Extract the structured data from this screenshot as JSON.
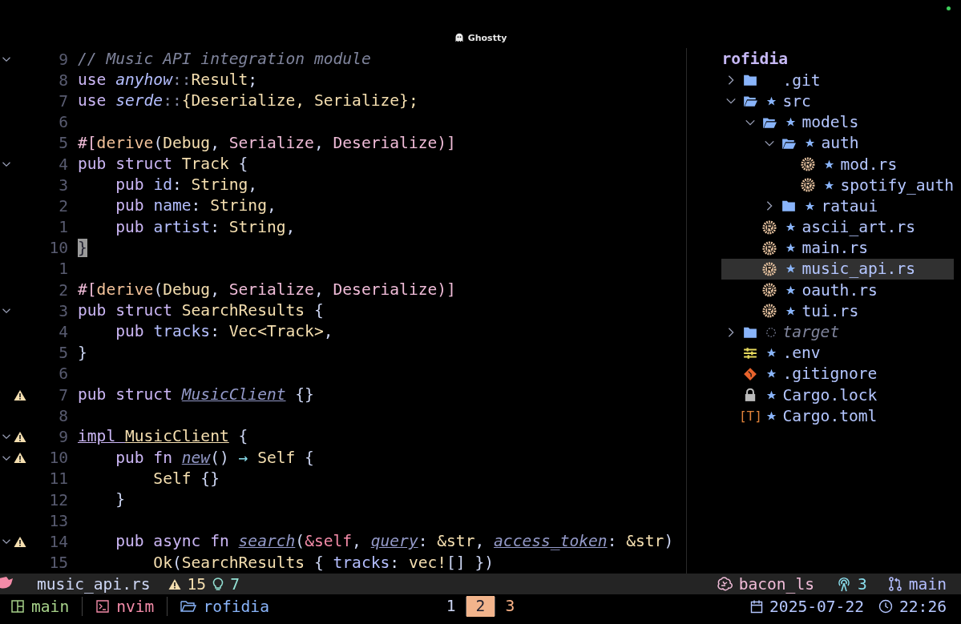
{
  "window": {
    "title": "Ghostty"
  },
  "editor": {
    "lines": [
      {
        "number": "9",
        "fold": true,
        "warning": false,
        "tokens": [
          {
            "text": "// Music API integration module",
            "kind": "comment"
          }
        ]
      },
      {
        "number": "8",
        "fold": false,
        "warning": false,
        "tokens": [
          {
            "text": "use ",
            "kind": "kw"
          },
          {
            "text": "anyhow",
            "kind": "ns"
          },
          {
            "text": "::",
            "kind": "dim"
          },
          {
            "text": "Result",
            "kind": "type"
          },
          {
            "text": ";",
            "kind": "punct"
          }
        ]
      },
      {
        "number": "7",
        "fold": false,
        "warning": false,
        "tokens": [
          {
            "text": "use ",
            "kind": "kw"
          },
          {
            "text": "serde",
            "kind": "ns"
          },
          {
            "text": "::",
            "kind": "dim"
          },
          {
            "text": "{Deserialize, Serialize};",
            "kind": "type"
          }
        ]
      },
      {
        "number": "6",
        "fold": false,
        "warning": false
      },
      {
        "number": "5",
        "fold": false,
        "warning": false,
        "tokens": [
          {
            "text": "#[",
            "kind": "attr"
          },
          {
            "text": "derive",
            "kind": "macro"
          },
          {
            "text": "(",
            "kind": "punct"
          },
          {
            "text": "Debug",
            "kind": "type"
          },
          {
            "text": ", ",
            "kind": "punct"
          },
          {
            "text": "Serialize",
            "kind": "attr"
          },
          {
            "text": ", ",
            "kind": "punct"
          },
          {
            "text": "Deserialize",
            "kind": "attr"
          },
          {
            "text": ")]",
            "kind": "attr"
          }
        ]
      },
      {
        "number": "4",
        "fold": true,
        "warning": false,
        "tokens": [
          {
            "text": "pub struct ",
            "kind": "kw"
          },
          {
            "text": "Track",
            "kind": "type"
          },
          {
            "text": " {",
            "kind": "punct"
          }
        ]
      },
      {
        "number": "3",
        "fold": false,
        "warning": false,
        "tokens": [
          {
            "text": "    pub ",
            "kind": "kw"
          },
          {
            "text": "id",
            "kind": "field"
          },
          {
            "text": ": ",
            "kind": "punct"
          },
          {
            "text": "String",
            "kind": "type"
          },
          {
            "text": ",",
            "kind": "punct"
          }
        ]
      },
      {
        "number": "2",
        "fold": false,
        "warning": false,
        "tokens": [
          {
            "text": "    pub ",
            "kind": "kw"
          },
          {
            "text": "name",
            "kind": "field"
          },
          {
            "text": ": ",
            "kind": "punct"
          },
          {
            "text": "String",
            "kind": "type"
          },
          {
            "text": ",",
            "kind": "punct"
          }
        ]
      },
      {
        "number": "1",
        "fold": false,
        "warning": false,
        "tokens": [
          {
            "text": "    pub ",
            "kind": "kw"
          },
          {
            "text": "artist",
            "kind": "field"
          },
          {
            "text": ": ",
            "kind": "punct"
          },
          {
            "text": "String",
            "kind": "type"
          },
          {
            "text": ",",
            "kind": "punct"
          }
        ]
      },
      {
        "number": "10",
        "fold": false,
        "warning": false,
        "tokens": [
          {
            "text": "}",
            "kind": "cursor"
          }
        ]
      },
      {
        "number": "1",
        "fold": false,
        "warning": false
      },
      {
        "number": "2",
        "fold": false,
        "warning": false,
        "tokens": [
          {
            "text": "#[",
            "kind": "attr"
          },
          {
            "text": "derive",
            "kind": "macro"
          },
          {
            "text": "(",
            "kind": "punct"
          },
          {
            "text": "Debug",
            "kind": "type"
          },
          {
            "text": ", ",
            "kind": "punct"
          },
          {
            "text": "Serialize",
            "kind": "attr"
          },
          {
            "text": ", ",
            "kind": "punct"
          },
          {
            "text": "Deserialize",
            "kind": "attr"
          },
          {
            "text": ")]",
            "kind": "attr"
          }
        ]
      },
      {
        "number": "3",
        "fold": true,
        "warning": false,
        "tokens": [
          {
            "text": "pub struct ",
            "kind": "kw"
          },
          {
            "text": "SearchResults",
            "kind": "type"
          },
          {
            "text": " {",
            "kind": "punct"
          }
        ]
      },
      {
        "number": "4",
        "fold": false,
        "warning": false,
        "tokens": [
          {
            "text": "    pub ",
            "kind": "kw"
          },
          {
            "text": "tracks",
            "kind": "field"
          },
          {
            "text": ": ",
            "kind": "punct"
          },
          {
            "text": "Vec<Track>",
            "kind": "type"
          },
          {
            "text": ",",
            "kind": "punct"
          }
        ]
      },
      {
        "number": "5",
        "fold": false,
        "warning": false,
        "tokens": [
          {
            "text": "}",
            "kind": "punct"
          }
        ]
      },
      {
        "number": "6",
        "fold": false,
        "warning": false
      },
      {
        "number": "7",
        "fold": false,
        "warning": true,
        "tokens": [
          {
            "text": "pub struct ",
            "kind": "kw"
          },
          {
            "text": "MusicClient",
            "kind": "unused"
          },
          {
            "text": " {}",
            "kind": "punct"
          }
        ]
      },
      {
        "number": "8",
        "fold": false,
        "warning": false
      },
      {
        "number": "9",
        "fold": true,
        "warning": true,
        "tokens": [
          {
            "text": "impl ",
            "kind": "kw-underline"
          },
          {
            "text": "MusicClient",
            "kind": "type-underline"
          },
          {
            "text": " {",
            "kind": "punct"
          }
        ]
      },
      {
        "number": "10",
        "fold": true,
        "warning": true,
        "tokens": [
          {
            "text": "    pub fn ",
            "kind": "kw"
          },
          {
            "text": "new",
            "kind": "unused"
          },
          {
            "text": "() ",
            "kind": "punct"
          },
          {
            "text": "→",
            "kind": "op"
          },
          {
            "text": " Self",
            "kind": "type"
          },
          {
            "text": " {",
            "kind": "punct"
          }
        ]
      },
      {
        "number": "11",
        "fold": false,
        "warning": false,
        "tokens": [
          {
            "text": "        Self",
            "kind": "type"
          },
          {
            "text": " {}",
            "kind": "punct"
          }
        ]
      },
      {
        "number": "12",
        "fold": false,
        "warning": false,
        "tokens": [
          {
            "text": "    }",
            "kind": "punct"
          }
        ]
      },
      {
        "number": "13",
        "fold": false,
        "warning": false
      },
      {
        "number": "14",
        "fold": true,
        "warning": true,
        "tokens": [
          {
            "text": "    pub async fn ",
            "kind": "kw"
          },
          {
            "text": "search",
            "kind": "unused"
          },
          {
            "text": "(",
            "kind": "punct"
          },
          {
            "text": "&self",
            "kind": "self"
          },
          {
            "text": ", ",
            "kind": "punct"
          },
          {
            "text": "query",
            "kind": "unused"
          },
          {
            "text": ": ",
            "kind": "punct"
          },
          {
            "text": "&str",
            "kind": "type"
          },
          {
            "text": ", ",
            "kind": "punct"
          },
          {
            "text": "access_token",
            "kind": "unused"
          },
          {
            "text": ": ",
            "kind": "punct"
          },
          {
            "text": "&str",
            "kind": "type"
          },
          {
            "text": ")",
            "kind": "punct"
          }
        ]
      },
      {
        "number": "15",
        "fold": false,
        "warning": false,
        "tokens": [
          {
            "text": "        Ok",
            "kind": "type"
          },
          {
            "text": "(",
            "kind": "punct"
          },
          {
            "text": "SearchResults",
            "kind": "type"
          },
          {
            "text": " { ",
            "kind": "punct"
          },
          {
            "text": "tracks",
            "kind": "field"
          },
          {
            "text": ": ",
            "kind": "punct"
          },
          {
            "text": "vec!",
            "kind": "type"
          },
          {
            "text": "[] })",
            "kind": "punct"
          }
        ]
      }
    ]
  },
  "tree": {
    "root": "rofidia",
    "items": [
      {
        "name": ".git",
        "kind": "folder",
        "expanded": false,
        "starred": false,
        "ignored": false,
        "selected": false
      },
      {
        "name": "src",
        "kind": "folder",
        "expanded": true,
        "starred": true,
        "ignored": false,
        "selected": false,
        "children": [
          {
            "name": "models",
            "kind": "folder",
            "expanded": true,
            "starred": true,
            "ignored": false,
            "selected": false,
            "children": [
              {
                "name": "auth",
                "kind": "folder",
                "expanded": true,
                "starred": true,
                "ignored": false,
                "selected": false,
                "children": [
                  {
                    "name": "mod.rs",
                    "kind": "rust",
                    "starred": true,
                    "ignored": false,
                    "selected": false
                  },
                  {
                    "name": "spotify_auth",
                    "kind": "rust",
                    "starred": true,
                    "ignored": false,
                    "selected": false
                  }
                ]
              },
              {
                "name": "rataui",
                "kind": "folder",
                "expanded": false,
                "starred": true,
                "ignored": false,
                "selected": false
              }
            ]
          },
          {
            "name": "ascii_art.rs",
            "kind": "rust",
            "starred": true,
            "ignored": false,
            "selected": false
          },
          {
            "name": "main.rs",
            "kind": "rust",
            "starred": true,
            "ignored": false,
            "selected": false
          },
          {
            "name": "music_api.rs",
            "kind": "rust",
            "starred": true,
            "ignored": false,
            "selected": true
          },
          {
            "name": "oauth.rs",
            "kind": "rust",
            "starred": true,
            "ignored": false,
            "selected": false
          },
          {
            "name": "tui.rs",
            "kind": "rust",
            "starred": true,
            "ignored": false,
            "selected": false
          }
        ]
      },
      {
        "name": "target",
        "kind": "folder",
        "expanded": false,
        "starred": false,
        "ignored": true,
        "selected": false
      },
      {
        "name": ".env",
        "kind": "env",
        "starred": true,
        "ignored": false,
        "selected": false
      },
      {
        "name": ".gitignore",
        "kind": "git",
        "starred": true,
        "ignored": false,
        "selected": false
      },
      {
        "name": "Cargo.lock",
        "kind": "lock",
        "starred": true,
        "ignored": false,
        "selected": false
      },
      {
        "name": "Cargo.toml",
        "kind": "toml",
        "glyph": "[T]",
        "starred": true,
        "ignored": false,
        "selected": false
      }
    ]
  },
  "statusline": {
    "file": "music_api.rs",
    "warnings": "15",
    "hints": "7",
    "lsp": "bacon_ls",
    "lsp_count": "3",
    "branch": "main"
  },
  "tmux": {
    "session": "main",
    "window": "nvim",
    "directory": "rofidia",
    "tabs": [
      {
        "label": "1",
        "selected": false,
        "color": "#cdd6f4"
      },
      {
        "label": "2",
        "selected": true,
        "color": "#f2b48c"
      },
      {
        "label": "3",
        "selected": false,
        "color": "#fab387"
      }
    ],
    "date": "2025-07-22",
    "time": "22:26"
  }
}
